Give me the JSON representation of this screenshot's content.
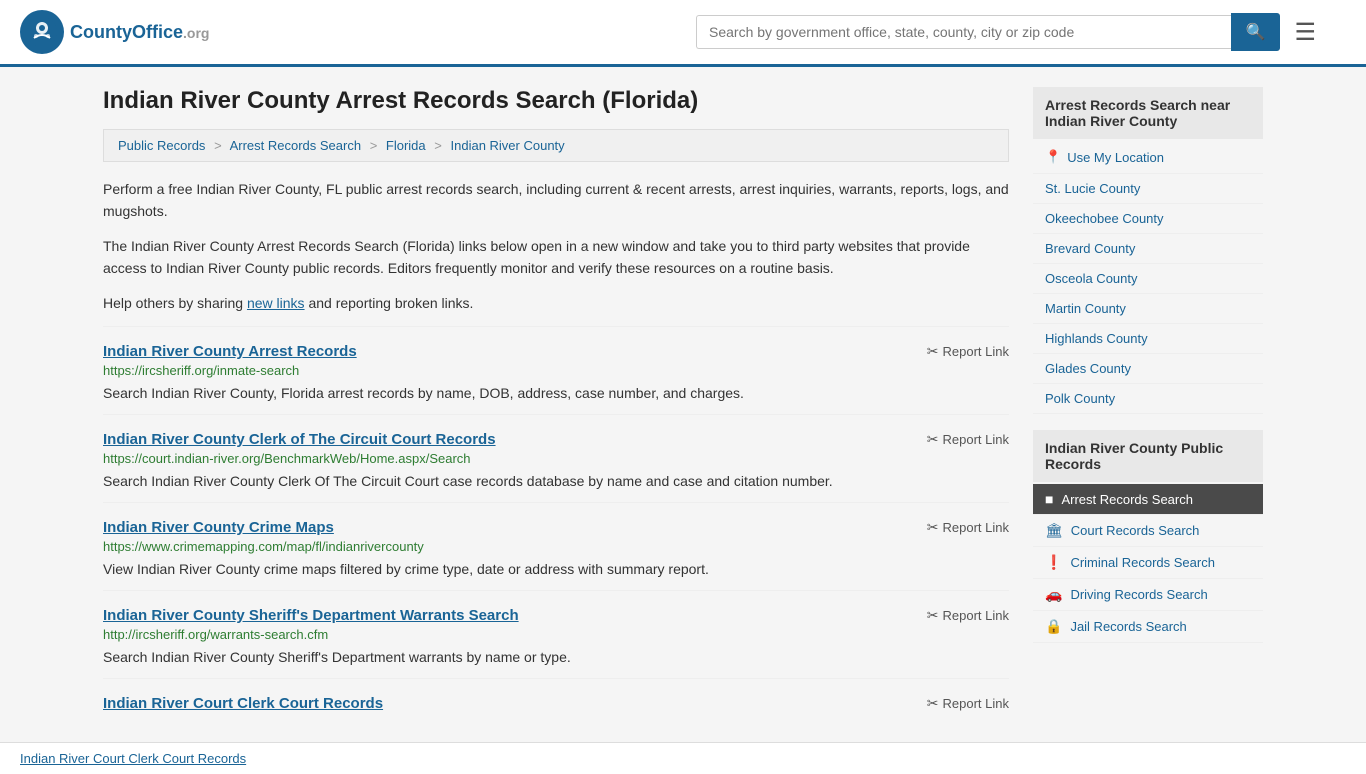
{
  "header": {
    "logo_name": "CountyOffice",
    "logo_org": ".org",
    "search_placeholder": "Search by government office, state, county, city or zip code"
  },
  "page": {
    "title": "Indian River County Arrest Records Search (Florida)",
    "breadcrumbs": [
      {
        "label": "Public Records",
        "href": "#"
      },
      {
        "label": "Arrest Records Search",
        "href": "#"
      },
      {
        "label": "Florida",
        "href": "#"
      },
      {
        "label": "Indian River County",
        "href": "#"
      }
    ],
    "desc1": "Perform a free Indian River County, FL public arrest records search, including current & recent arrests, arrest inquiries, warrants, reports, logs, and mugshots.",
    "desc2": "The Indian River County Arrest Records Search (Florida) links below open in a new window and take you to third party websites that provide access to Indian River County public records. Editors frequently monitor and verify these resources on a routine basis.",
    "desc3_pre": "Help others by sharing ",
    "desc3_link": "new links",
    "desc3_post": " and reporting broken links."
  },
  "records": [
    {
      "title": "Indian River County Arrest Records",
      "url": "https://ircsheriff.org/inmate-search",
      "desc": "Search Indian River County, Florida arrest records by name, DOB, address, case number, and charges.",
      "report": "Report Link"
    },
    {
      "title": "Indian River County Clerk of The Circuit Court Records",
      "url": "https://court.indian-river.org/BenchmarkWeb/Home.aspx/Search",
      "desc": "Search Indian River County Clerk Of The Circuit Court case records database by name and case and citation number.",
      "report": "Report Link"
    },
    {
      "title": "Indian River County Crime Maps",
      "url": "https://www.crimemapping.com/map/fl/indianrivercounty",
      "desc": "View Indian River County crime maps filtered by crime type, date or address with summary report.",
      "report": "Report Link"
    },
    {
      "title": "Indian River County Sheriff's Department Warrants Search",
      "url": "http://ircsheriff.org/warrants-search.cfm",
      "desc": "Search Indian River County Sheriff's Department warrants by name or type.",
      "report": "Report Link"
    },
    {
      "title": "Indian River Court Clerk Court Records",
      "url": "",
      "desc": "",
      "report": "Report Link"
    }
  ],
  "sidebar": {
    "nearby_title": "Arrest Records Search near Indian River County",
    "use_location": "Use My Location",
    "nearby_counties": [
      "St. Lucie County",
      "Okeechobee County",
      "Brevard County",
      "Osceola County",
      "Martin County",
      "Highlands County",
      "Glades County",
      "Polk County"
    ],
    "public_records_title": "Indian River County Public Records",
    "public_records_items": [
      {
        "label": "Arrest Records Search",
        "icon": "■",
        "active": true
      },
      {
        "label": "Court Records Search",
        "icon": "🏛",
        "active": false
      },
      {
        "label": "Criminal Records Search",
        "icon": "❗",
        "active": false
      },
      {
        "label": "Driving Records Search",
        "icon": "🚗",
        "active": false
      },
      {
        "label": "Jail Records Search",
        "icon": "🔒",
        "active": false
      }
    ]
  },
  "footer": {
    "link": "Indian River Court Clerk Court Records"
  }
}
